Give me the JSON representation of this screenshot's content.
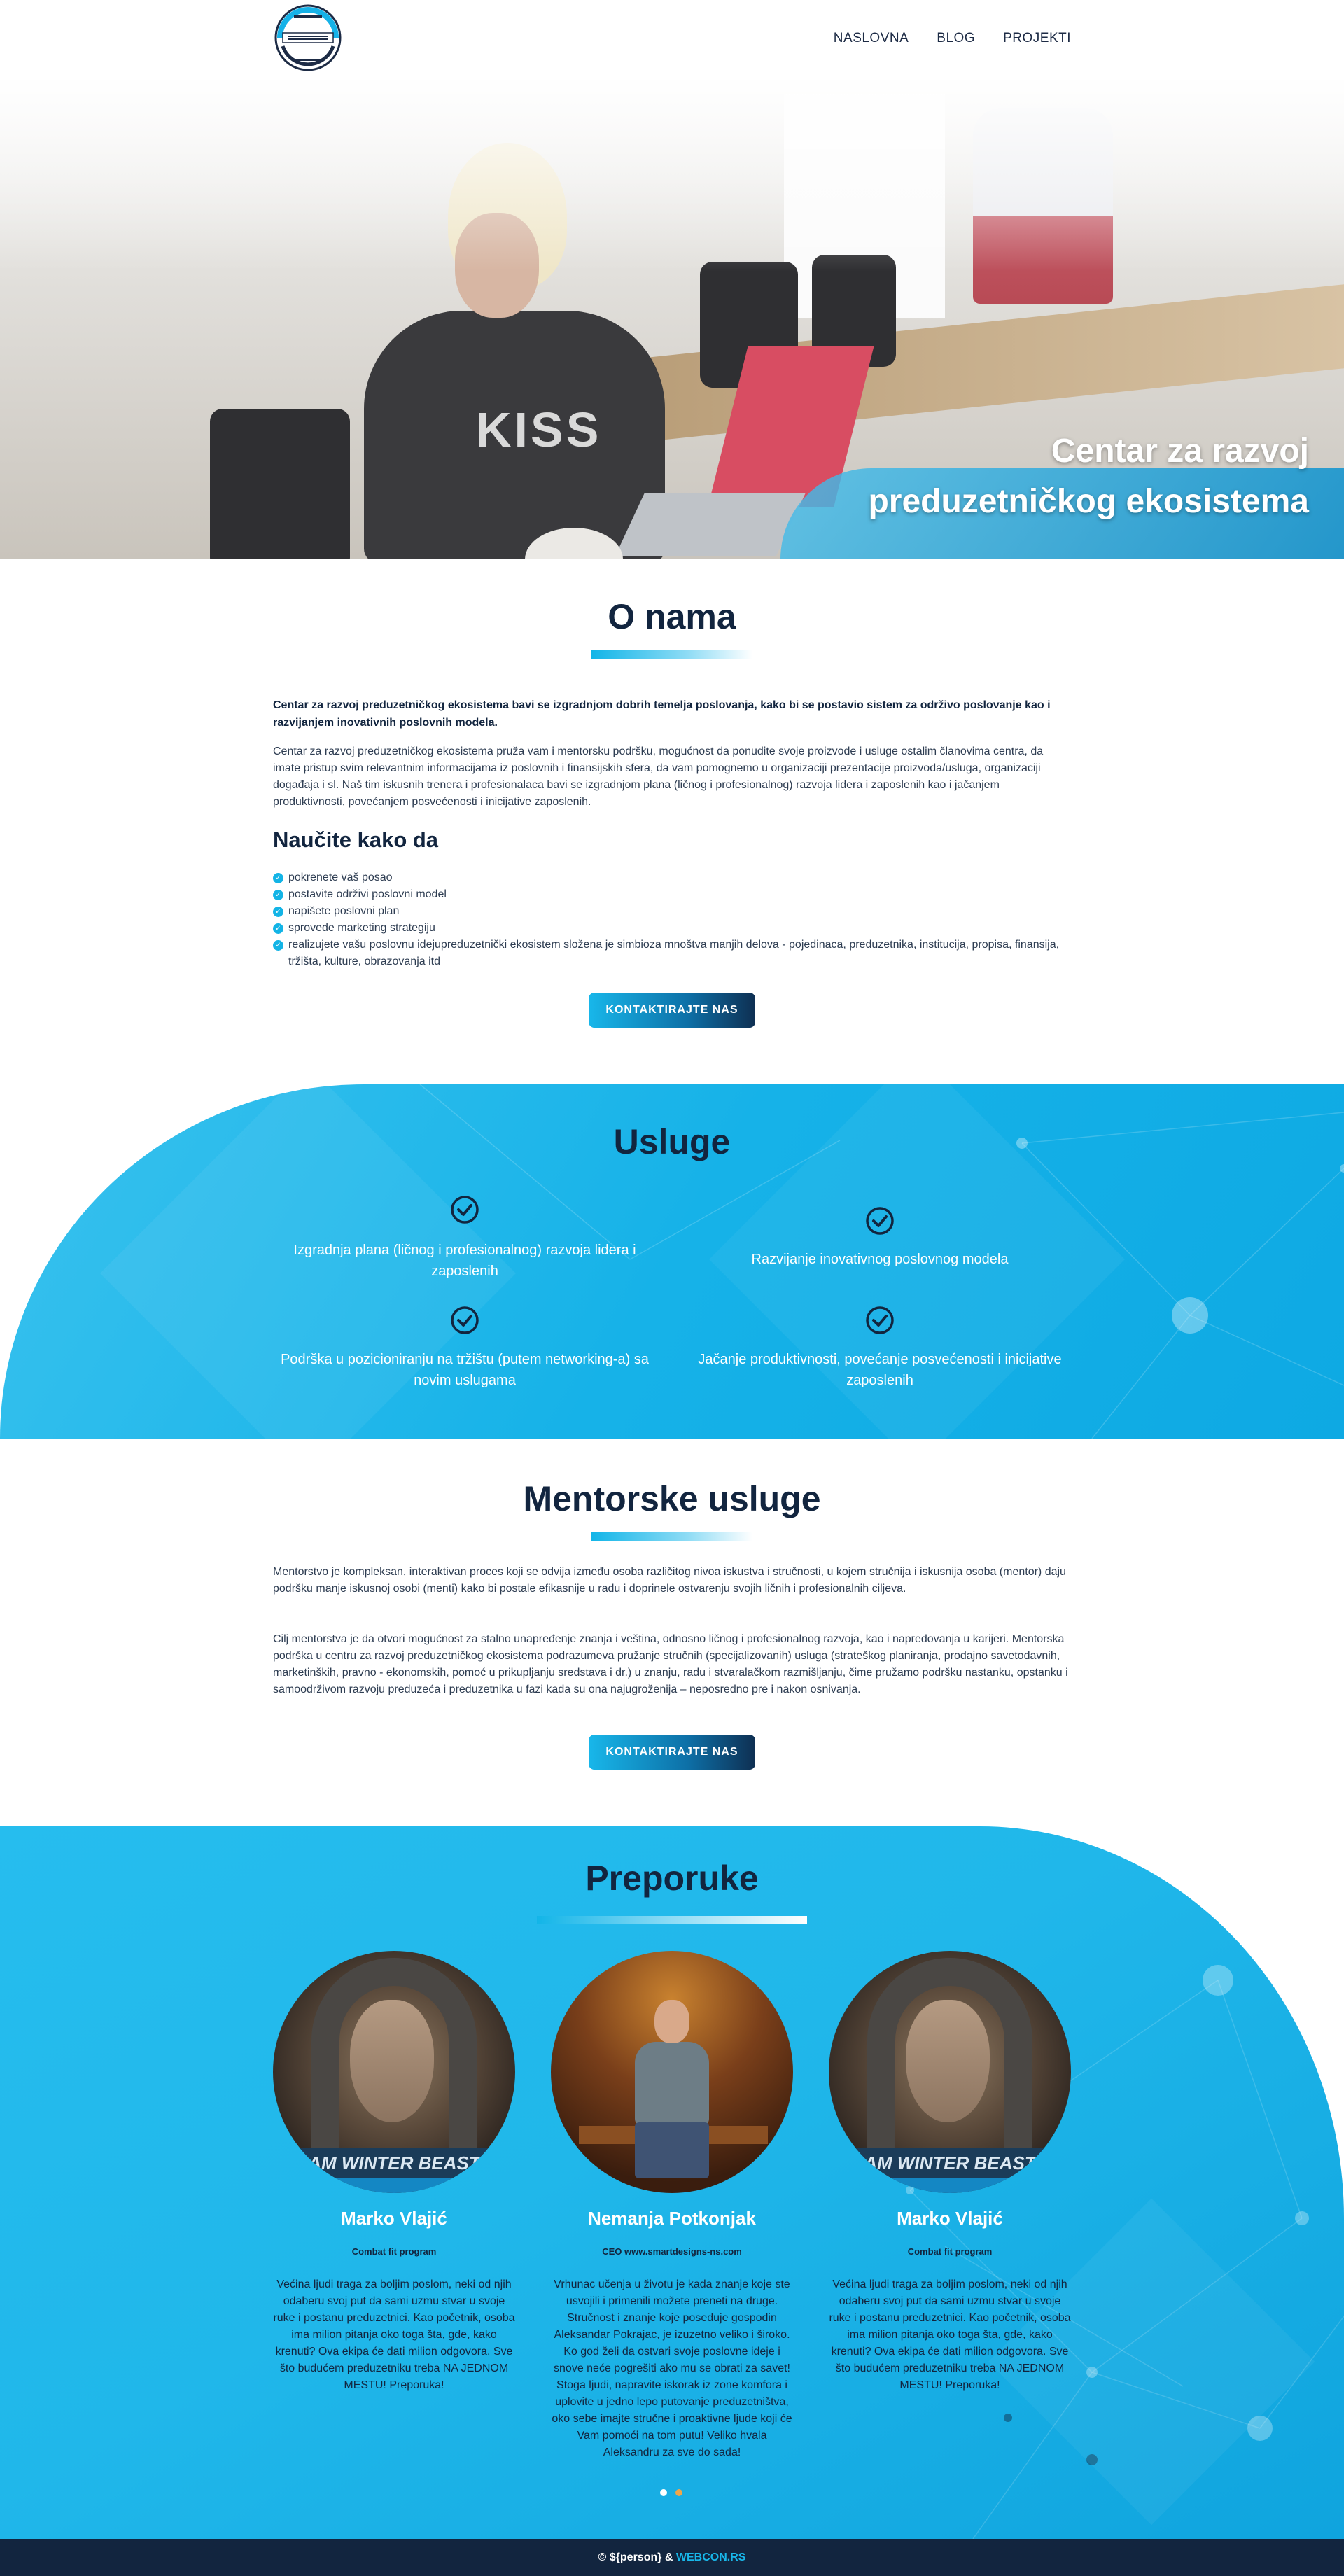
{
  "header": {
    "logo_alt": "Centar za razvoj preduzetničkog ekosistema",
    "nav": [
      "NASLOVNA",
      "BLOG",
      "PROJEKTI"
    ]
  },
  "hero": {
    "title_line1": "Centar za razvoj",
    "title_line2": "preduzetničkog ekosistema"
  },
  "about": {
    "title": "O nama",
    "intro": "Centar za razvoj preduzetničkog ekosistema bavi se izgradnjom dobrih temelja poslovanja, kako bi se postavio sistem za održivo poslovanje kao i razvijanjem inovativnih poslovnih modela.",
    "body": "Centar za razvoj preduzetničkog ekosistema pruža vam i mentorsku podršku, mogućnost da ponudite svoje proizvode i usluge ostalim članovima centra, da imate pristup svim relevantnim informacijama iz poslovnih i finansijskih sfera, da vam pomognemo u organizaciji prezentacije proizvoda/usluga, organizaciji događaja i sl. Naš tim iskusnih trenera i profesionalaca bavi se izgradnjom plana (ličnog i profesionalnog) razvoja lidera i zaposlenih kao i jačanjem produktivnosti, povećanjem posvećenosti i inicijative zaposlenih.",
    "learn_title": "Naučite kako da",
    "learn_items": [
      "pokrenete vaš posao",
      "postavite održivi poslovni model",
      "napišete poslovni plan",
      "sprovede marketing strategiju",
      "realizujete vašu poslovnu idejupreduzetnički ekosistem složena je simbioza mnoštva manjih delova - pojedinaca, preduzetnika, institucija, propisa, finansija, tržišta, kulture, obrazovanja itd"
    ],
    "cta": "KONTAKTIRAJTE NAS"
  },
  "services": {
    "title": "Usluge",
    "items": [
      "Izgradnja plana (ličnog i profesionalnog) razvoja lidera i zaposlenih",
      "Razvijanje inovativnog poslovnog modela",
      "Podrška u pozicioniranju na tržištu (putem networking-a) sa novim uslugama",
      "Jačanje produktivnosti, povećanje posvećenosti i inicijative zaposlenih"
    ]
  },
  "mentoring": {
    "title": "Mentorske usluge",
    "p1": "Mentorstvo je kompleksan, interaktivan proces koji se odvija između osoba različitog nivoa iskustva i stručnosti, u kojem stručnija i iskusnija osoba (mentor) daju podršku manje iskusnoj osobi (menti) kako bi postale efikasnije u radu i doprinele ostvarenju svojih ličnih i profesionalnih ciljeva.",
    "p2": "Cilj mentorstva je da otvori mogućnost za stalno unapređenje znanja i veština, odnosno ličnog i profesionalnog razvoja, kao i napredovanja u karijeri. Mentorska podrška u centru za razvoj preduzetničkog ekosistema podrazumeva pružanje stručnih (specijalizovanih) usluga (strateškog planiranja, prodajno savetodavnih, marketinških, pravno - ekonomskih, pomoć u prikupljanju sredstava i dr.) u znanju, radu i stvaralačkom razmišljanju, čime pružamo podršku nastanku, opstanku i samoodrživom razvoju preduzeća i preduzetnika u fazi kada su ona najugroženija – neposredno pre i nakon osnivanja.",
    "cta": "KONTAKTIRAJTE NAS"
  },
  "recommendations": {
    "title": "Preporuke",
    "banner_text": "AM WINTER BEAST",
    "items": [
      {
        "name": "Marko Vlajić",
        "role": "Combat fit program",
        "text": "Većina ljudi traga za boljim poslom, neki od njih odaberu svoj put da sami uzmu stvar u svoje ruke i postanu preduzetnici. Kao početnik, osoba ima milion pitanja oko toga šta, gde, kako krenuti? Ova ekipa će dati milion odgovora. Sve što budućem preduzetniku treba NA JEDNOM MESTU! Preporuka!"
      },
      {
        "name": "Nemanja Potkonjak",
        "role": "CEO www.smartdesigns-ns.com",
        "text": "Vrhunac učenja u životu je kada znanje koje ste usvojili i primenili možete preneti na druge. Stručnost i znanje koje poseduje gospodin Aleksandar Pokrajac, je izuzetno veliko i široko. Ko god želi da ostvari svoje poslovne ideje i snove neće pogrešiti ako mu se obrati za savet! Stoga ljudi, napravite iskorak iz zone komfora i uplovite u jedno lepo putovanje preduzetništva, oko sebe imajte stručne i proaktivne ljude koji će Vam pomoći na tom putu! Veliko hvala Aleksandru za sve do sada!"
      },
      {
        "name": "Marko Vlajić",
        "role": "Combat fit program",
        "text": "Većina ljudi traga za boljim poslom, neki od njih odaberu svoj put da sami uzmu stvar u svoje ruke i postanu preduzetnici. Kao početnik, osoba ima milion pitanja oko toga šta, gde, kako krenuti? Ova ekipa će dati milion odgovora. Sve što budućem preduzetniku treba NA JEDNOM MESTU! Preporuka!"
      }
    ],
    "carousel": {
      "active_index": 0,
      "count": 2
    }
  },
  "footer": {
    "prefix": "© ${person} & ",
    "link": "WEBCON.RS"
  },
  "colors": {
    "primary_dark": "#12253f",
    "accent_blue": "#16b2e8",
    "carousel_active": "#ffffff",
    "carousel_inactive": "#f0a64a"
  }
}
